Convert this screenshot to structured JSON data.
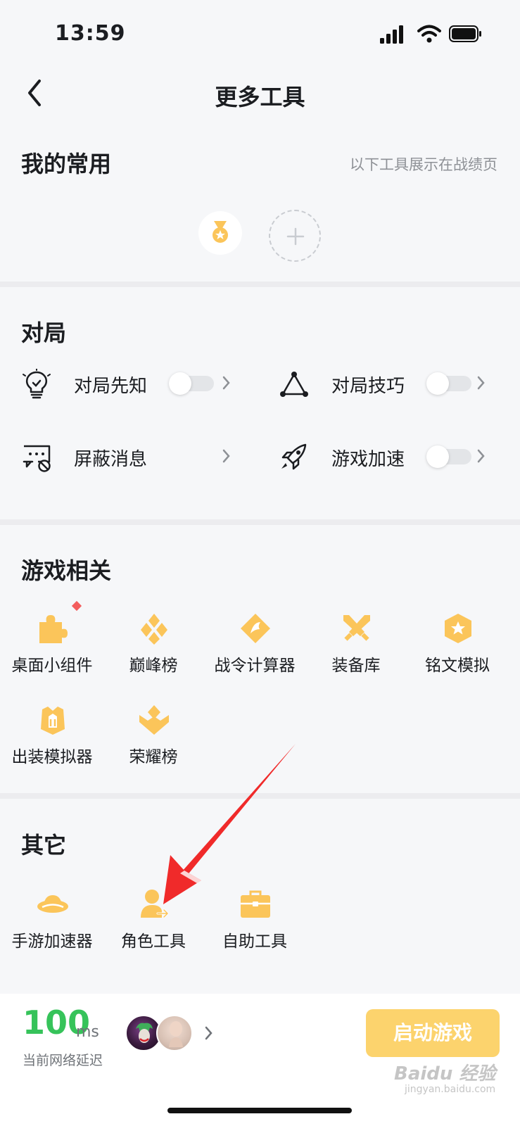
{
  "status_bar": {
    "time": "13:59"
  },
  "header": {
    "title": "更多工具"
  },
  "my_favorites": {
    "title": "我的常用",
    "note": "以下工具展示在战绩页"
  },
  "match": {
    "title": "对局",
    "items": [
      {
        "label": "对局先知",
        "icon": "lightbulb-icon",
        "has_toggle": true,
        "toggle_on": false
      },
      {
        "label": "对局技巧",
        "icon": "triangle-nodes-icon",
        "has_toggle": true,
        "toggle_on": false
      },
      {
        "label": "屏蔽消息",
        "icon": "message-block-icon",
        "has_toggle": false
      },
      {
        "label": "游戏加速",
        "icon": "rocket-icon",
        "has_toggle": true,
        "toggle_on": false
      }
    ]
  },
  "game_related": {
    "title": "游戏相关",
    "items": [
      {
        "label": "桌面小组件",
        "icon": "puzzle-icon"
      },
      {
        "label": "巅峰榜",
        "icon": "peak-badge-icon"
      },
      {
        "label": "战令计算器",
        "icon": "battle-pass-icon"
      },
      {
        "label": "装备库",
        "icon": "crossed-swords-icon"
      },
      {
        "label": "铭文模拟",
        "icon": "hexagon-star-icon"
      },
      {
        "label": "出装模拟器",
        "icon": "armor-icon"
      },
      {
        "label": "荣耀榜",
        "icon": "honor-badge-icon"
      }
    ]
  },
  "others": {
    "title": "其它",
    "items": [
      {
        "label": "手游加速器",
        "icon": "ufo-icon"
      },
      {
        "label": "角色工具",
        "icon": "user-transfer-icon"
      },
      {
        "label": "自助工具",
        "icon": "toolbox-icon"
      }
    ]
  },
  "bottom_bar": {
    "latency_value": "100",
    "latency_unit": "ms",
    "latency_label": "当前网络延迟",
    "launch_label": "启动游戏"
  },
  "watermark": {
    "brand": "Baidu 经验",
    "url": "jingyan.baidu.com"
  },
  "colors": {
    "accent_yellow": "#fcc64a",
    "icon_yellow": "#fbc55a",
    "latency_green": "#36c35a",
    "annotation_red": "#f02a2a"
  }
}
